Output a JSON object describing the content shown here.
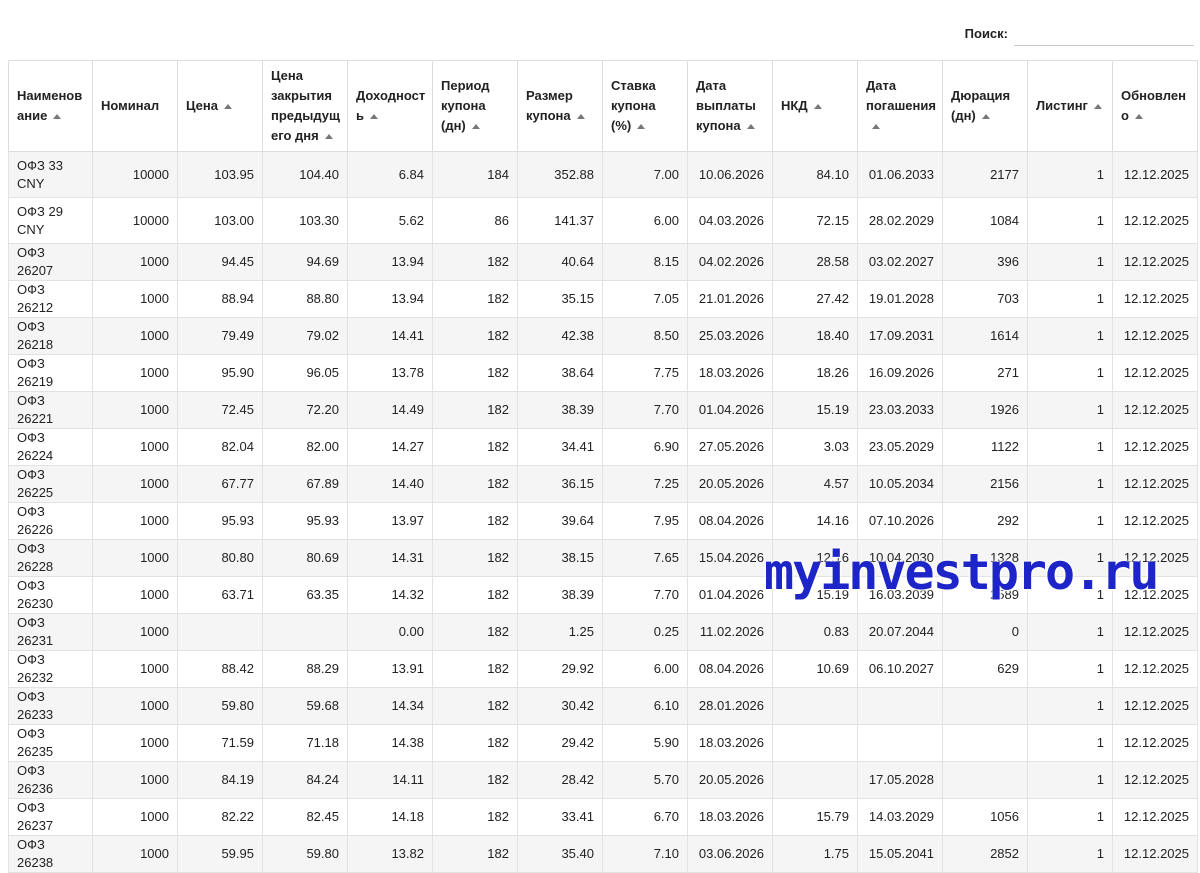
{
  "search": {
    "label": "Поиск:",
    "value": ""
  },
  "columns": [
    {
      "key": "name",
      "label": "Наименов ание",
      "sortable": true
    },
    {
      "key": "nominal",
      "label": "Номинал",
      "sortable": false
    },
    {
      "key": "price",
      "label": "Цена",
      "sortable": true
    },
    {
      "key": "prev_close",
      "label": "Цена закрытия предыдущ его дня",
      "sortable": true
    },
    {
      "key": "yield",
      "label": "Доходност ь",
      "sortable": true
    },
    {
      "key": "coupon_period",
      "label": "Период купона (дн)",
      "sortable": true
    },
    {
      "key": "coupon_size",
      "label": "Размер купона",
      "sortable": true
    },
    {
      "key": "coupon_rate",
      "label": "Ставка купона (%)",
      "sortable": true
    },
    {
      "key": "coupon_date",
      "label": "Дата выплаты купона",
      "sortable": true
    },
    {
      "key": "nkd",
      "label": "НКД",
      "sortable": true
    },
    {
      "key": "maturity",
      "label": "Дата погашения",
      "sortable": true
    },
    {
      "key": "duration",
      "label": "Дюрация (дн)",
      "sortable": true
    },
    {
      "key": "listing",
      "label": "Листинг",
      "sortable": true
    },
    {
      "key": "updated",
      "label": "Обновлен о",
      "sortable": true
    }
  ],
  "rows": [
    [
      "ОФЗ 33 CNY",
      "10000",
      "103.95",
      "104.40",
      "6.84",
      "184",
      "352.88",
      "7.00",
      "10.06.2026",
      "84.10",
      "01.06.2033",
      "2177",
      "1",
      "12.12.2025"
    ],
    [
      "ОФЗ 29 CNY",
      "10000",
      "103.00",
      "103.30",
      "5.62",
      "86",
      "141.37",
      "6.00",
      "04.03.2026",
      "72.15",
      "28.02.2029",
      "1084",
      "1",
      "12.12.2025"
    ],
    [
      "ОФЗ 26207",
      "1000",
      "94.45",
      "94.69",
      "13.94",
      "182",
      "40.64",
      "8.15",
      "04.02.2026",
      "28.58",
      "03.02.2027",
      "396",
      "1",
      "12.12.2025"
    ],
    [
      "ОФЗ 26212",
      "1000",
      "88.94",
      "88.80",
      "13.94",
      "182",
      "35.15",
      "7.05",
      "21.01.2026",
      "27.42",
      "19.01.2028",
      "703",
      "1",
      "12.12.2025"
    ],
    [
      "ОФЗ 26218",
      "1000",
      "79.49",
      "79.02",
      "14.41",
      "182",
      "42.38",
      "8.50",
      "25.03.2026",
      "18.40",
      "17.09.2031",
      "1614",
      "1",
      "12.12.2025"
    ],
    [
      "ОФЗ 26219",
      "1000",
      "95.90",
      "96.05",
      "13.78",
      "182",
      "38.64",
      "7.75",
      "18.03.2026",
      "18.26",
      "16.09.2026",
      "271",
      "1",
      "12.12.2025"
    ],
    [
      "ОФЗ 26221",
      "1000",
      "72.45",
      "72.20",
      "14.49",
      "182",
      "38.39",
      "7.70",
      "01.04.2026",
      "15.19",
      "23.03.2033",
      "1926",
      "1",
      "12.12.2025"
    ],
    [
      "ОФЗ 26224",
      "1000",
      "82.04",
      "82.00",
      "14.27",
      "182",
      "34.41",
      "6.90",
      "27.05.2026",
      "3.03",
      "23.05.2029",
      "1122",
      "1",
      "12.12.2025"
    ],
    [
      "ОФЗ 26225",
      "1000",
      "67.77",
      "67.89",
      "14.40",
      "182",
      "36.15",
      "7.25",
      "20.05.2026",
      "4.57",
      "10.05.2034",
      "2156",
      "1",
      "12.12.2025"
    ],
    [
      "ОФЗ 26226",
      "1000",
      "95.93",
      "95.93",
      "13.97",
      "182",
      "39.64",
      "7.95",
      "08.04.2026",
      "14.16",
      "07.10.2026",
      "292",
      "1",
      "12.12.2025"
    ],
    [
      "ОФЗ 26228",
      "1000",
      "80.80",
      "80.69",
      "14.31",
      "182",
      "38.15",
      "7.65",
      "15.04.2026",
      "12.16",
      "10.04.2030",
      "1328",
      "1",
      "12.12.2025"
    ],
    [
      "ОФЗ 26230",
      "1000",
      "63.71",
      "63.35",
      "14.32",
      "182",
      "38.39",
      "7.70",
      "01.04.2026",
      "15.19",
      "16.03.2039",
      "2589",
      "1",
      "12.12.2025"
    ],
    [
      "ОФЗ 26231",
      "1000",
      "",
      "",
      "0.00",
      "182",
      "1.25",
      "0.25",
      "11.02.2026",
      "0.83",
      "20.07.2044",
      "0",
      "1",
      "12.12.2025"
    ],
    [
      "ОФЗ 26232",
      "1000",
      "88.42",
      "88.29",
      "13.91",
      "182",
      "29.92",
      "6.00",
      "08.04.2026",
      "10.69",
      "06.10.2027",
      "629",
      "1",
      "12.12.2025"
    ],
    [
      "ОФЗ 26233",
      "1000",
      "59.80",
      "59.68",
      "14.34",
      "182",
      "30.42",
      "6.10",
      "28.01.2026",
      "",
      "",
      "",
      "1",
      "12.12.2025"
    ],
    [
      "ОФЗ 26235",
      "1000",
      "71.59",
      "71.18",
      "14.38",
      "182",
      "29.42",
      "5.90",
      "18.03.2026",
      "",
      "",
      "",
      "1",
      "12.12.2025"
    ],
    [
      "ОФЗ 26236",
      "1000",
      "84.19",
      "84.24",
      "14.11",
      "182",
      "28.42",
      "5.70",
      "20.05.2026",
      "",
      "17.05.2028",
      "",
      "1",
      "12.12.2025"
    ],
    [
      "ОФЗ 26237",
      "1000",
      "82.22",
      "82.45",
      "14.18",
      "182",
      "33.41",
      "6.70",
      "18.03.2026",
      "15.79",
      "14.03.2029",
      "1056",
      "1",
      "12.12.2025"
    ],
    [
      "ОФЗ 26238",
      "1000",
      "59.95",
      "59.80",
      "13.82",
      "182",
      "35.40",
      "7.10",
      "03.06.2026",
      "1.75",
      "15.05.2041",
      "2852",
      "1",
      "12.12.2025"
    ]
  ],
  "watermark": {
    "text": "myinvestpro.ru",
    "color": "#1d24c8"
  },
  "icons": {
    "sort": "sort-asc-icon"
  }
}
